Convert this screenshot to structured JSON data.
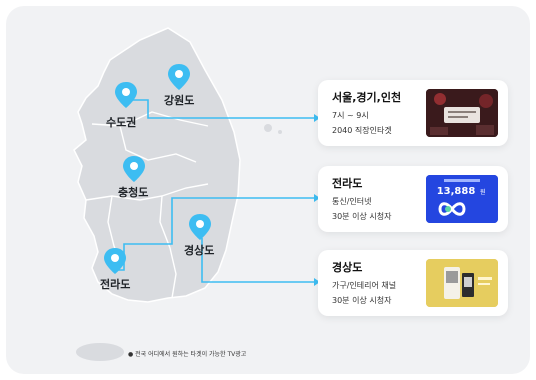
{
  "regions": {
    "gangwon": "강원도",
    "sudogwon": "수도권",
    "chungcheong": "충청도",
    "gyeongsang": "경상도",
    "jeolla": "전라도"
  },
  "cards": [
    {
      "title": "서울,경기,인천",
      "line1": "7시 ~ 9시",
      "line2": "2040 직장인타겟"
    },
    {
      "title": "전라도",
      "line1": "통신/인터넷",
      "line2": "30분 이상 시청자",
      "thumb_amount": "13,888"
    },
    {
      "title": "경상도",
      "line1": "가구/인테리어 채널",
      "line2": "30분 이상 시청자"
    }
  ],
  "footnote": "● 전국 어디에서 원하는 타겟이 가능한 TV광고",
  "colors": {
    "accent": "#3dbdf2",
    "map_fill": "#d9dbdf",
    "map_stroke": "#ffffff"
  }
}
